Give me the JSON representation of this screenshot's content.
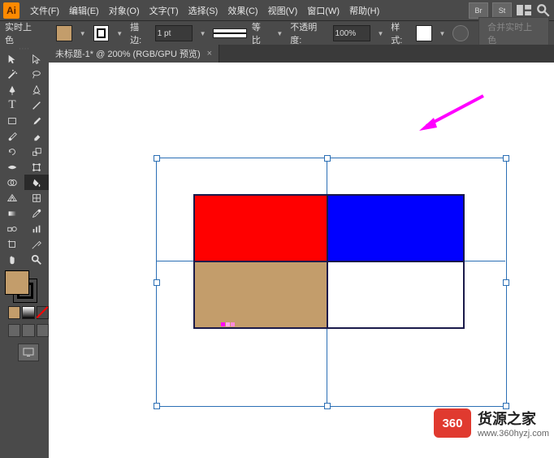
{
  "menubar": {
    "items": [
      "文件(F)",
      "编辑(E)",
      "对象(O)",
      "文字(T)",
      "选择(S)",
      "效果(C)",
      "视图(V)",
      "窗口(W)",
      "帮助(H)"
    ],
    "right_btns": [
      "Br",
      "St"
    ]
  },
  "controlbar": {
    "mode_label": "实时上色",
    "stroke_label": "描边:",
    "stroke_weight": "1 pt",
    "uniform_label": "等比",
    "opacity_label": "不透明度:",
    "opacity_value": "100%",
    "style_label": "样式:",
    "disabled_btn": "合并实时上色"
  },
  "tab": {
    "title": "未标题-1* @ 200% (RGB/GPU 预览)",
    "close": "×"
  },
  "tools": {
    "row0": [
      "selection",
      "direct-selection"
    ],
    "row1": [
      "magic-wand",
      "lasso"
    ],
    "row2": [
      "pen",
      "curvature"
    ],
    "row3": [
      "type",
      "line"
    ],
    "row4": [
      "rectangle",
      "brush"
    ],
    "row5": [
      "shaper",
      "eraser"
    ],
    "row6": [
      "rotate",
      "scale"
    ],
    "row7": [
      "width",
      "free-transform"
    ],
    "row8": [
      "shape-builder",
      "live-paint"
    ],
    "row9": [
      "perspective",
      "mesh"
    ],
    "row10": [
      "gradient",
      "eyedropper"
    ],
    "row11": [
      "blend",
      "column-graph"
    ],
    "row12": [
      "artboard",
      "slice"
    ],
    "row13": [
      "hand",
      "zoom"
    ]
  },
  "colors": {
    "fill": "#c39d6b",
    "stroke": "#000000",
    "red_rect": "#ff0000",
    "blue_rect": "#0000ff",
    "tan_rect": "#c39d6b",
    "select_outline": "#2b6fb5",
    "arrow": "#ff00ff"
  },
  "watermark": {
    "logo_text": "360",
    "title": "货源之家",
    "url": "www.360hyzj.com"
  }
}
